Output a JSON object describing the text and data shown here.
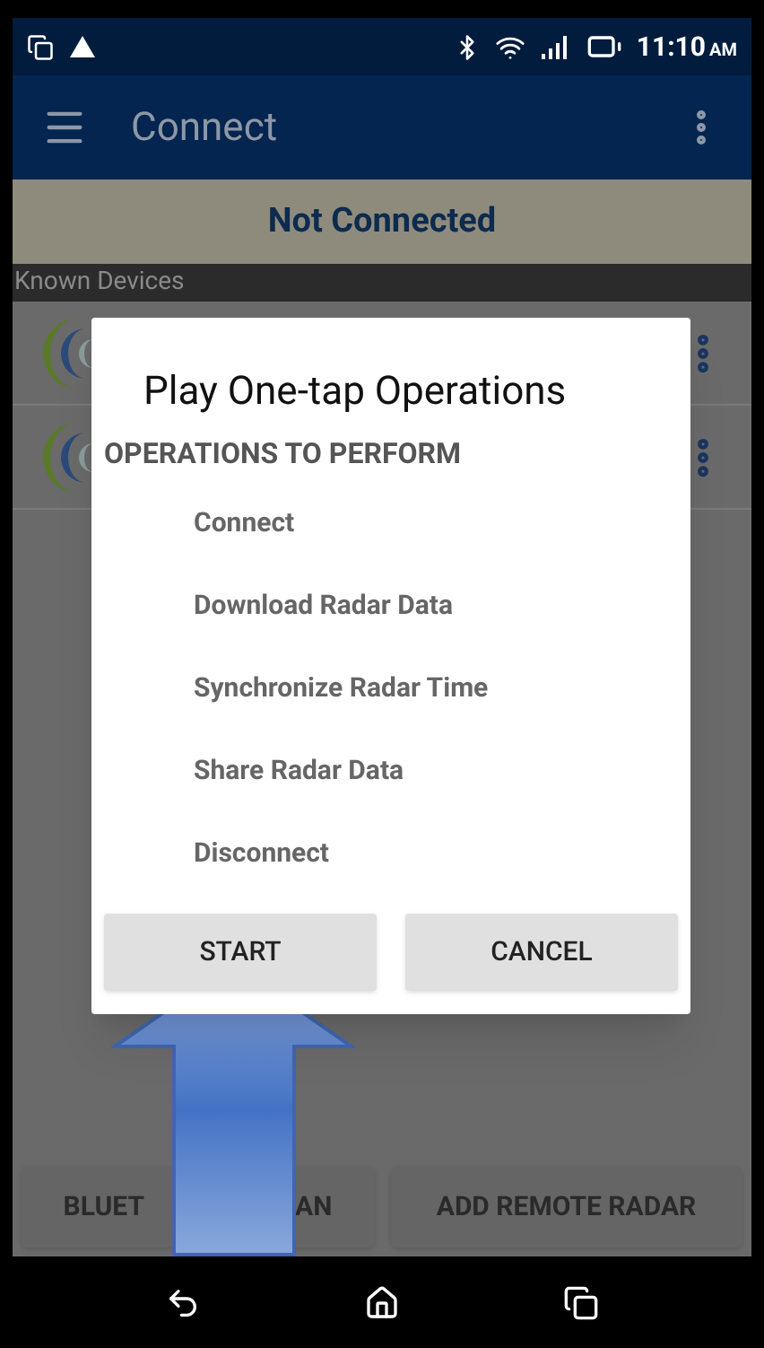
{
  "status_bar": {
    "time": "11:10",
    "ampm": "AM"
  },
  "app_bar": {
    "title": "Connect"
  },
  "connection_status": "Not Connected",
  "section_header": "Known Devices",
  "dialog": {
    "title": "Play One-tap Operations",
    "subtitle": "OPERATIONS TO PERFORM",
    "operations": [
      "Connect",
      "Download Radar Data",
      "Synchronize Radar Time",
      "Share Radar Data",
      "Disconnect"
    ],
    "buttons": [
      "START",
      "CANCEL"
    ]
  },
  "bottom_buttons": [
    {
      "label": "BLUET",
      "label_end": "AN"
    },
    {
      "label": "ADD REMOTE RADAR"
    }
  ]
}
